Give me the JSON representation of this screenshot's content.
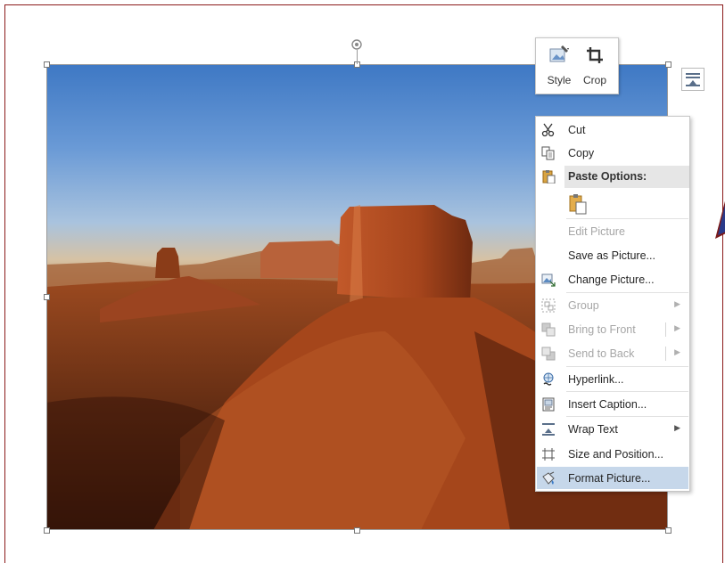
{
  "mini_toolbar": {
    "style_label": "Style",
    "crop_label": "Crop"
  },
  "context_menu": {
    "items": [
      {
        "label": "Cut",
        "icon": "scissors-icon",
        "state": "enabled"
      },
      {
        "label": "Copy",
        "icon": "copy-icon",
        "state": "enabled"
      },
      {
        "label": "Paste Options:",
        "icon": "clipboard-icon",
        "state": "header"
      },
      {
        "label": "",
        "icon": "paste-keep-source-icon",
        "state": "enabled"
      },
      {
        "label": "Edit Picture",
        "icon": "",
        "state": "disabled"
      },
      {
        "label": "Save as Picture...",
        "icon": "",
        "state": "enabled"
      },
      {
        "label": "Change Picture...",
        "icon": "change-picture-icon",
        "state": "enabled"
      },
      {
        "label": "Group",
        "icon": "group-icon",
        "state": "disabled",
        "submenu": true
      },
      {
        "label": "Bring to Front",
        "icon": "bring-to-front-icon",
        "state": "disabled",
        "submenu": true
      },
      {
        "label": "Send to Back",
        "icon": "send-to-back-icon",
        "state": "disabled",
        "submenu": true
      },
      {
        "label": "Hyperlink...",
        "icon": "hyperlink-icon",
        "state": "enabled"
      },
      {
        "label": "Insert Caption...",
        "icon": "caption-icon",
        "state": "enabled"
      },
      {
        "label": "Wrap Text",
        "icon": "wrap-text-icon",
        "state": "enabled",
        "submenu": true
      },
      {
        "label": "Size and Position...",
        "icon": "size-position-icon",
        "state": "enabled"
      },
      {
        "label": "Format Picture...",
        "icon": "format-picture-icon",
        "state": "highlighted"
      }
    ]
  },
  "colors": {
    "frame_border": "#8b1a1a",
    "menu_highlight": "#c6d7ea",
    "disabled_text": "#a6a6a6"
  }
}
